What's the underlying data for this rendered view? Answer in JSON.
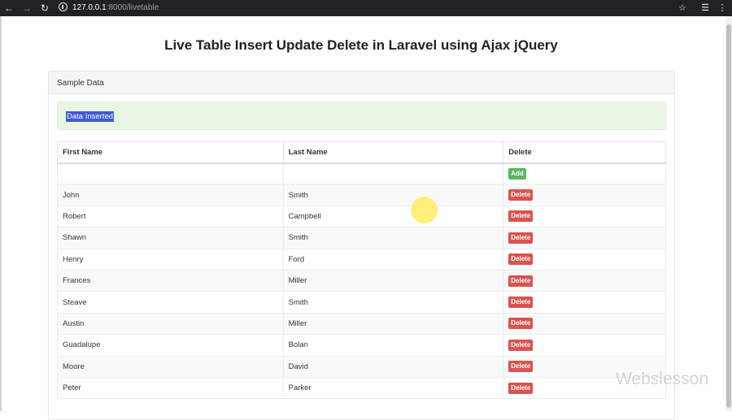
{
  "browser": {
    "url_host": "127.0.0.1",
    "url_rest": ":8000/livetable"
  },
  "page": {
    "title": "Live Table Insert Update Delete in Laravel using Ajax jQuery"
  },
  "panel": {
    "heading": "Sample Data",
    "alert_text": "Data Inserted"
  },
  "table": {
    "headers": [
      "First Name",
      "Last Name",
      "Delete"
    ],
    "add_label": "Add",
    "delete_label": "Delete",
    "rows": [
      {
        "first": "John",
        "last": "Smith"
      },
      {
        "first": "Robert",
        "last": "Campbell"
      },
      {
        "first": "Shawn",
        "last": "Smith"
      },
      {
        "first": "Henry",
        "last": "Ford"
      },
      {
        "first": "Frances",
        "last": "Miller"
      },
      {
        "first": "Steave",
        "last": "Smith"
      },
      {
        "first": "Austin",
        "last": "Miller"
      },
      {
        "first": "Guadalupe",
        "last": "Bolan"
      },
      {
        "first": "Moore",
        "last": "David"
      },
      {
        "first": "Peter",
        "last": "Parker"
      }
    ]
  },
  "watermark": "Webslesson",
  "colors": {
    "add_button": "#5cb85c",
    "delete_button": "#d9534f",
    "alert_bg": "#e9f6e4"
  }
}
